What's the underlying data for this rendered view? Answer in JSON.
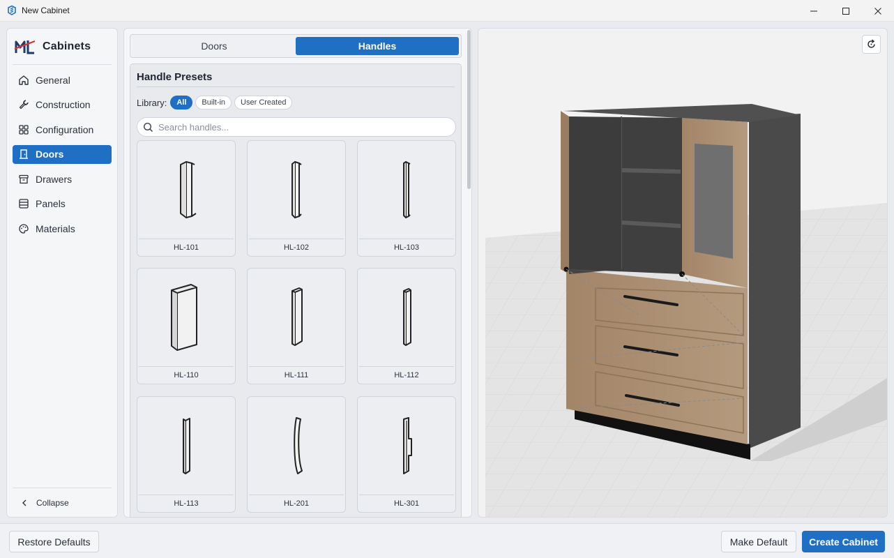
{
  "window": {
    "title": "New Cabinet",
    "controls": [
      "minimize-icon",
      "maximize-icon",
      "close-icon"
    ]
  },
  "sidebar": {
    "brand": "Cabinets",
    "items": [
      {
        "label": "General",
        "icon": "home-icon",
        "active": false
      },
      {
        "label": "Construction",
        "icon": "wrench-icon",
        "active": false
      },
      {
        "label": "Configuration",
        "icon": "grid-icon",
        "active": false
      },
      {
        "label": "Doors",
        "icon": "door-icon",
        "active": true
      },
      {
        "label": "Drawers",
        "icon": "archive-icon",
        "active": false
      },
      {
        "label": "Panels",
        "icon": "panels-icon",
        "active": false
      },
      {
        "label": "Materials",
        "icon": "palette-icon",
        "active": false
      }
    ],
    "collapse_label": "Collapse"
  },
  "tabs": [
    {
      "label": "Doors",
      "active": false
    },
    {
      "label": "Handles",
      "active": true
    }
  ],
  "presets": {
    "title": "Handle Presets",
    "library_label": "Library:",
    "filters": [
      {
        "label": "All",
        "active": true
      },
      {
        "label": "Built-in",
        "active": false
      },
      {
        "label": "User Created",
        "active": false
      }
    ],
    "search_placeholder": "Search handles...",
    "search_value": "",
    "items": [
      {
        "name": "HL-101"
      },
      {
        "name": "HL-102"
      },
      {
        "name": "HL-103"
      },
      {
        "name": "HL-110"
      },
      {
        "name": "HL-111"
      },
      {
        "name": "HL-112"
      },
      {
        "name": "HL-113"
      },
      {
        "name": "HL-201"
      },
      {
        "name": "HL-301"
      }
    ]
  },
  "footer": {
    "restore": "Restore Defaults",
    "make_default": "Make Default",
    "create": "Create Cabinet"
  },
  "colors": {
    "accent": "#1f6fc5",
    "wood": "#a88a6e",
    "cabinet_body": "#4a4a4a"
  }
}
